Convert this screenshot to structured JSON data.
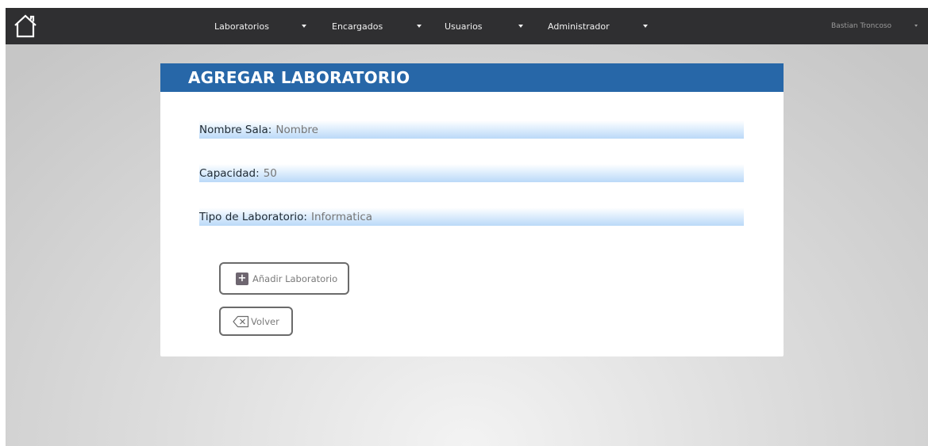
{
  "navbar": {
    "home_icon": "home-icon",
    "items": [
      {
        "label": "Laboratorios"
      },
      {
        "label": "Encargados"
      },
      {
        "label": "Usuarios"
      },
      {
        "label": "Administrador"
      }
    ],
    "user": "Bastian Troncoso"
  },
  "form": {
    "title": "AGREGAR LABORATORIO",
    "fields": [
      {
        "label": "Nombre Sala:",
        "placeholder": "Nombre",
        "value": ""
      },
      {
        "label": "Capacidad:",
        "placeholder": "50",
        "value": ""
      },
      {
        "label": "Tipo de Laboratorio:",
        "placeholder": "Informatica",
        "value": ""
      }
    ],
    "add_button": {
      "label": "Añadir Laboratorio",
      "icon": "plus-icon"
    },
    "back_button": {
      "label": "Volver",
      "icon": "backspace-icon"
    }
  },
  "colors": {
    "navbar_bg": "#2f2f31",
    "header_bg": "#2767a8",
    "field_gradient_end": "#bad9f8"
  }
}
